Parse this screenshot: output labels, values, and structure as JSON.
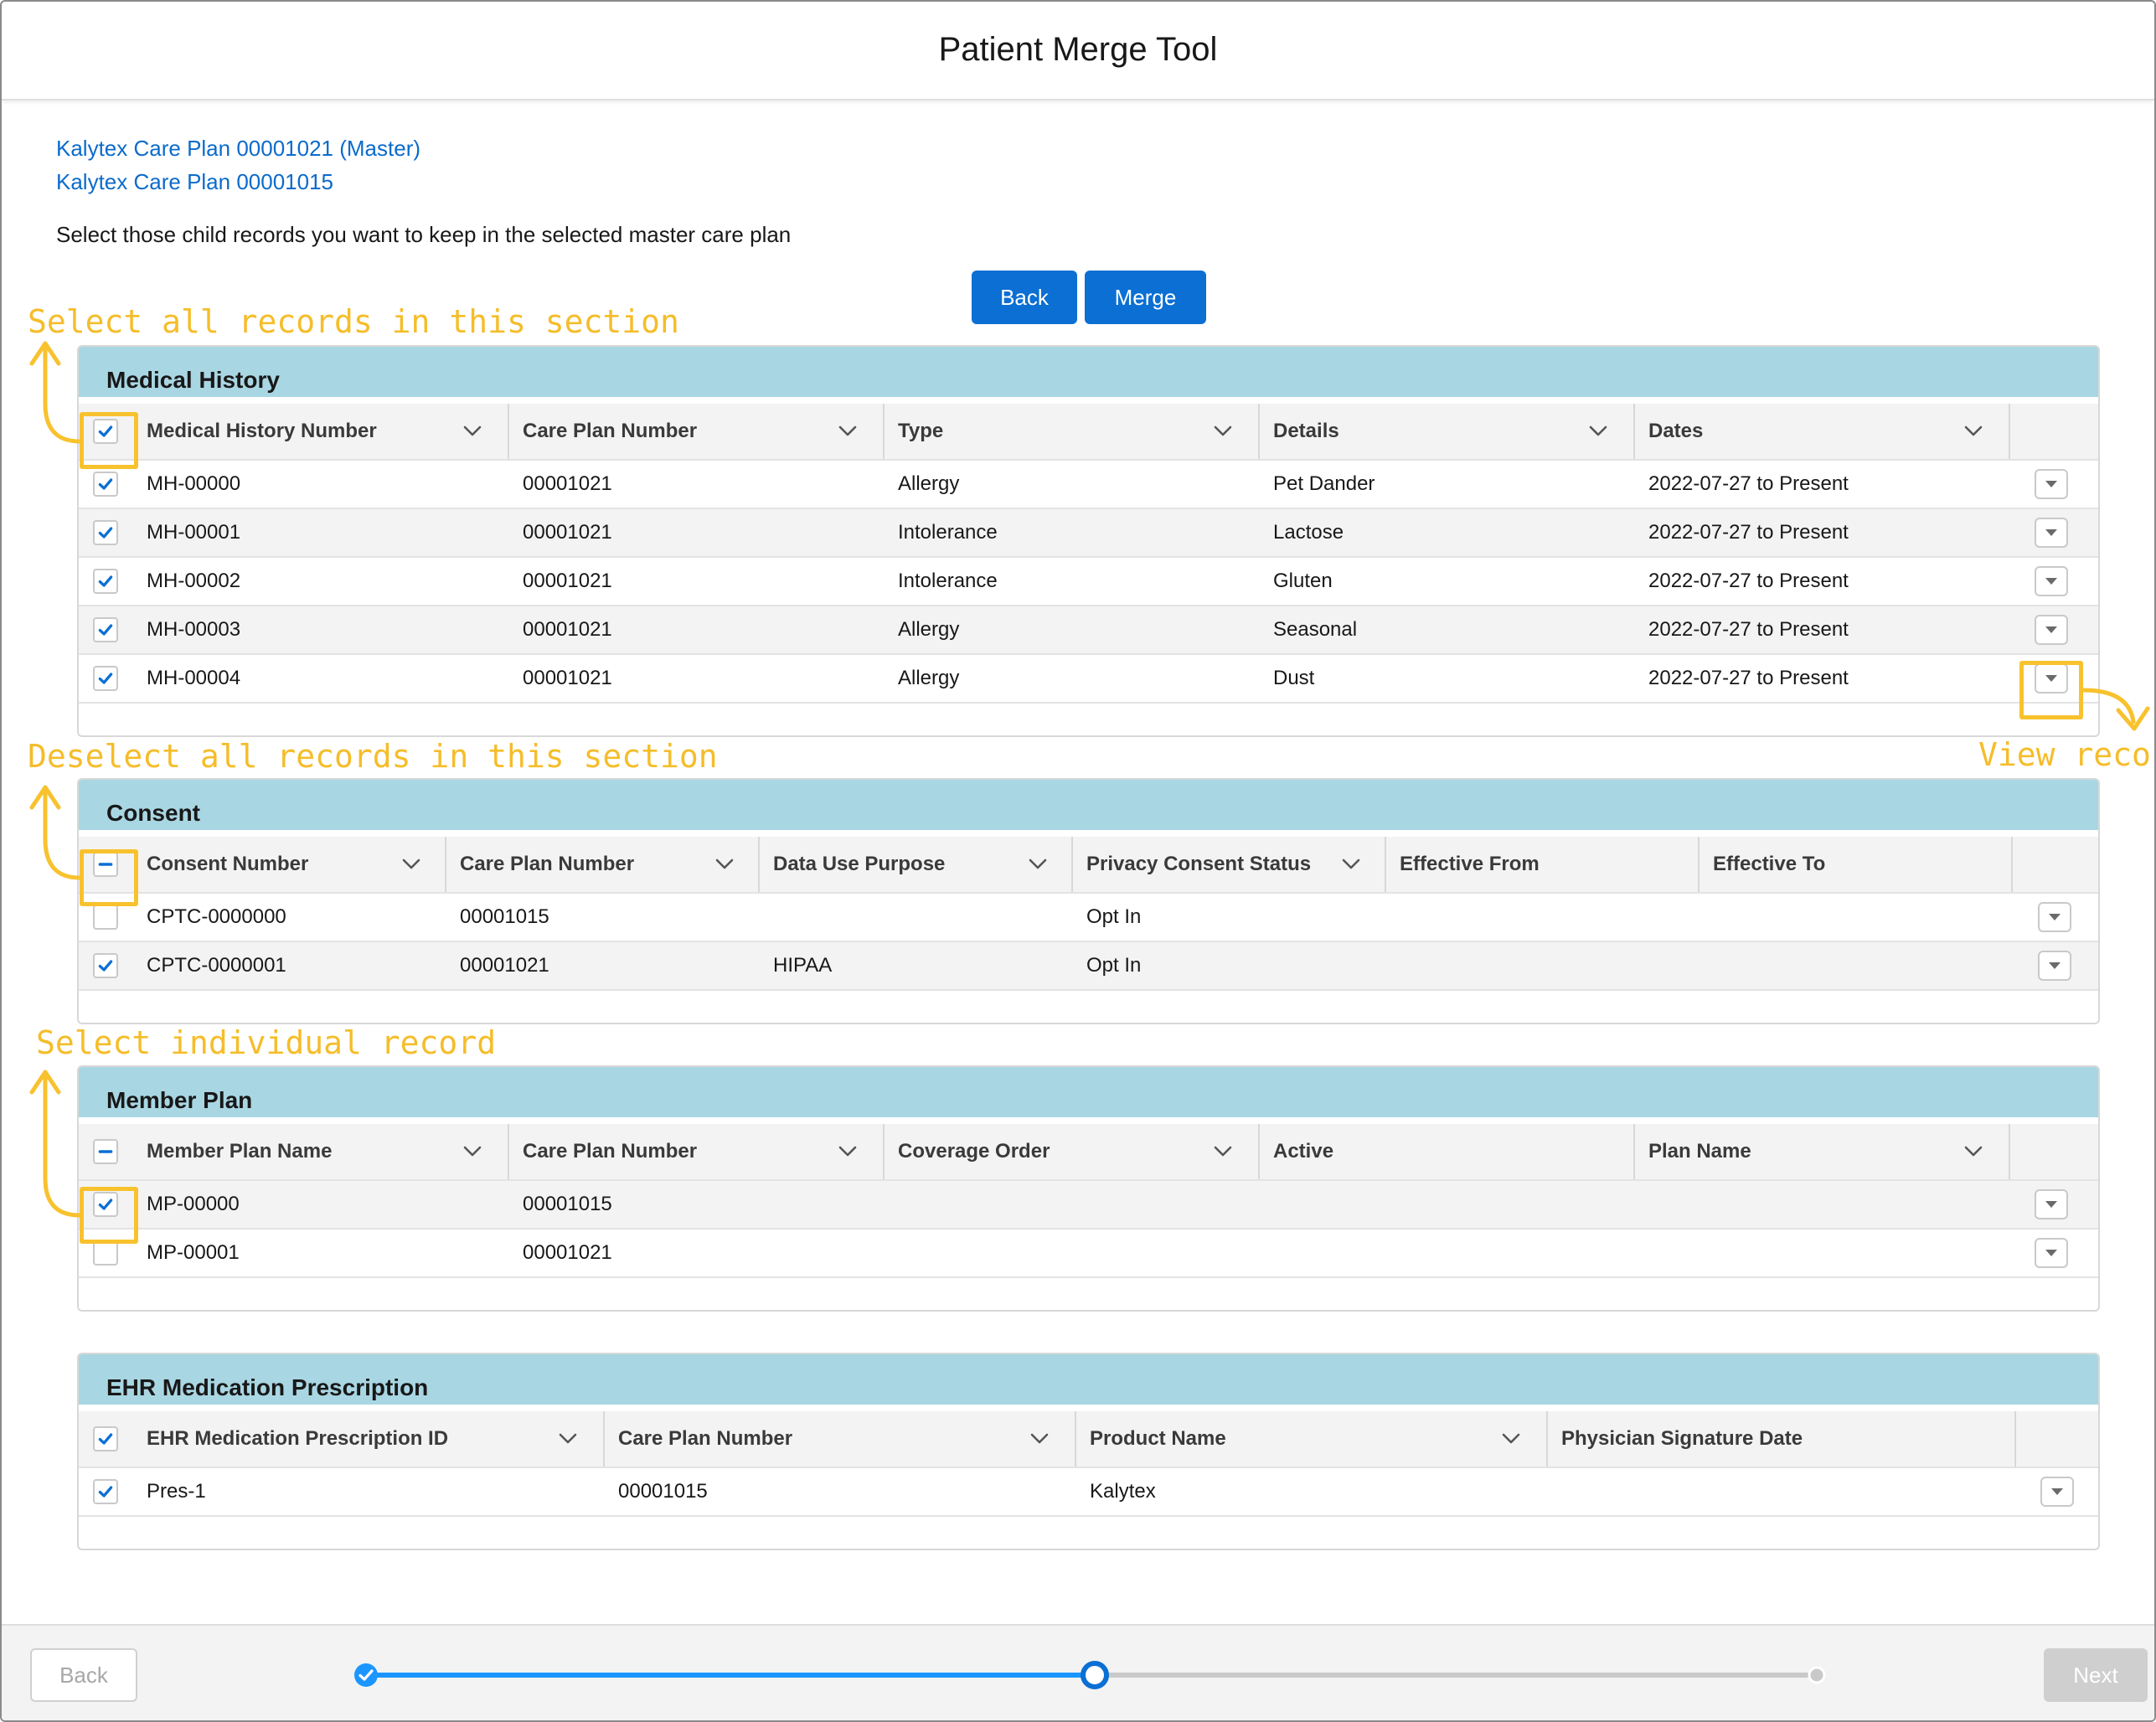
{
  "modal": {
    "title": "Patient Merge Tool"
  },
  "care_plans": [
    "Kalytex Care Plan 00001021 (Master)",
    "Kalytex Care Plan 00001015"
  ],
  "instruction": "Select those child records you want to keep in the selected master care plan",
  "actions": {
    "back_label": "Back",
    "merge_label": "Merge"
  },
  "sections": {
    "medical_history": {
      "title": "Medical History",
      "columns": [
        "Medical History Number",
        "Care Plan Number",
        "Type",
        "Details",
        "Dates"
      ],
      "rows": [
        [
          "MH-00000",
          "00001021",
          "Allergy",
          "Pet Dander",
          "2022-07-27 to Present"
        ],
        [
          "MH-00001",
          "00001021",
          "Intolerance",
          "Lactose",
          "2022-07-27 to Present"
        ],
        [
          "MH-00002",
          "00001021",
          "Intolerance",
          "Gluten",
          "2022-07-27 to Present"
        ],
        [
          "MH-00003",
          "00001021",
          "Allergy",
          "Seasonal",
          "2022-07-27 to Present"
        ],
        [
          "MH-00004",
          "00001021",
          "Allergy",
          "Dust",
          "2022-07-27 to Present"
        ]
      ]
    },
    "consent": {
      "title": "Consent",
      "columns": [
        "Consent Number",
        "Care Plan Number",
        "Data Use Purpose",
        "Privacy Consent Status",
        "Effective From",
        "Effective To"
      ],
      "rows": [
        [
          "CPTC-0000000",
          "00001015",
          "",
          "Opt In",
          "",
          ""
        ],
        [
          "CPTC-0000001",
          "00001021",
          "HIPAA",
          "Opt In",
          "",
          ""
        ]
      ]
    },
    "member_plan": {
      "title": "Member Plan",
      "columns": [
        "Member Plan Name",
        "Care Plan Number",
        "Coverage Order",
        "Active",
        "Plan Name"
      ],
      "rows": [
        [
          "MP-00000",
          "00001015",
          "",
          "",
          ""
        ],
        [
          "MP-00001",
          "00001021",
          "",
          "",
          ""
        ]
      ]
    },
    "ehr": {
      "title": "EHR Medication Prescription",
      "columns": [
        "EHR Medication Prescription ID",
        "Care Plan Number",
        "Product Name",
        "Physician Signature Date"
      ],
      "rows": [
        [
          "Pres-1",
          "00001015",
          "Kalytex",
          ""
        ]
      ]
    }
  },
  "annotations": {
    "select_all": "Select all records in this section",
    "deselect_all": "Deselect all records in this section",
    "select_individual": "Select individual record",
    "view_record": "View record"
  },
  "footer": {
    "back_label": "Back",
    "next_label": "Next"
  },
  "colors": {
    "accent": "#0b6fd3",
    "link": "#0b6bcb",
    "section_header": "#a9d6e3",
    "annotation": "#f5bd2a"
  }
}
